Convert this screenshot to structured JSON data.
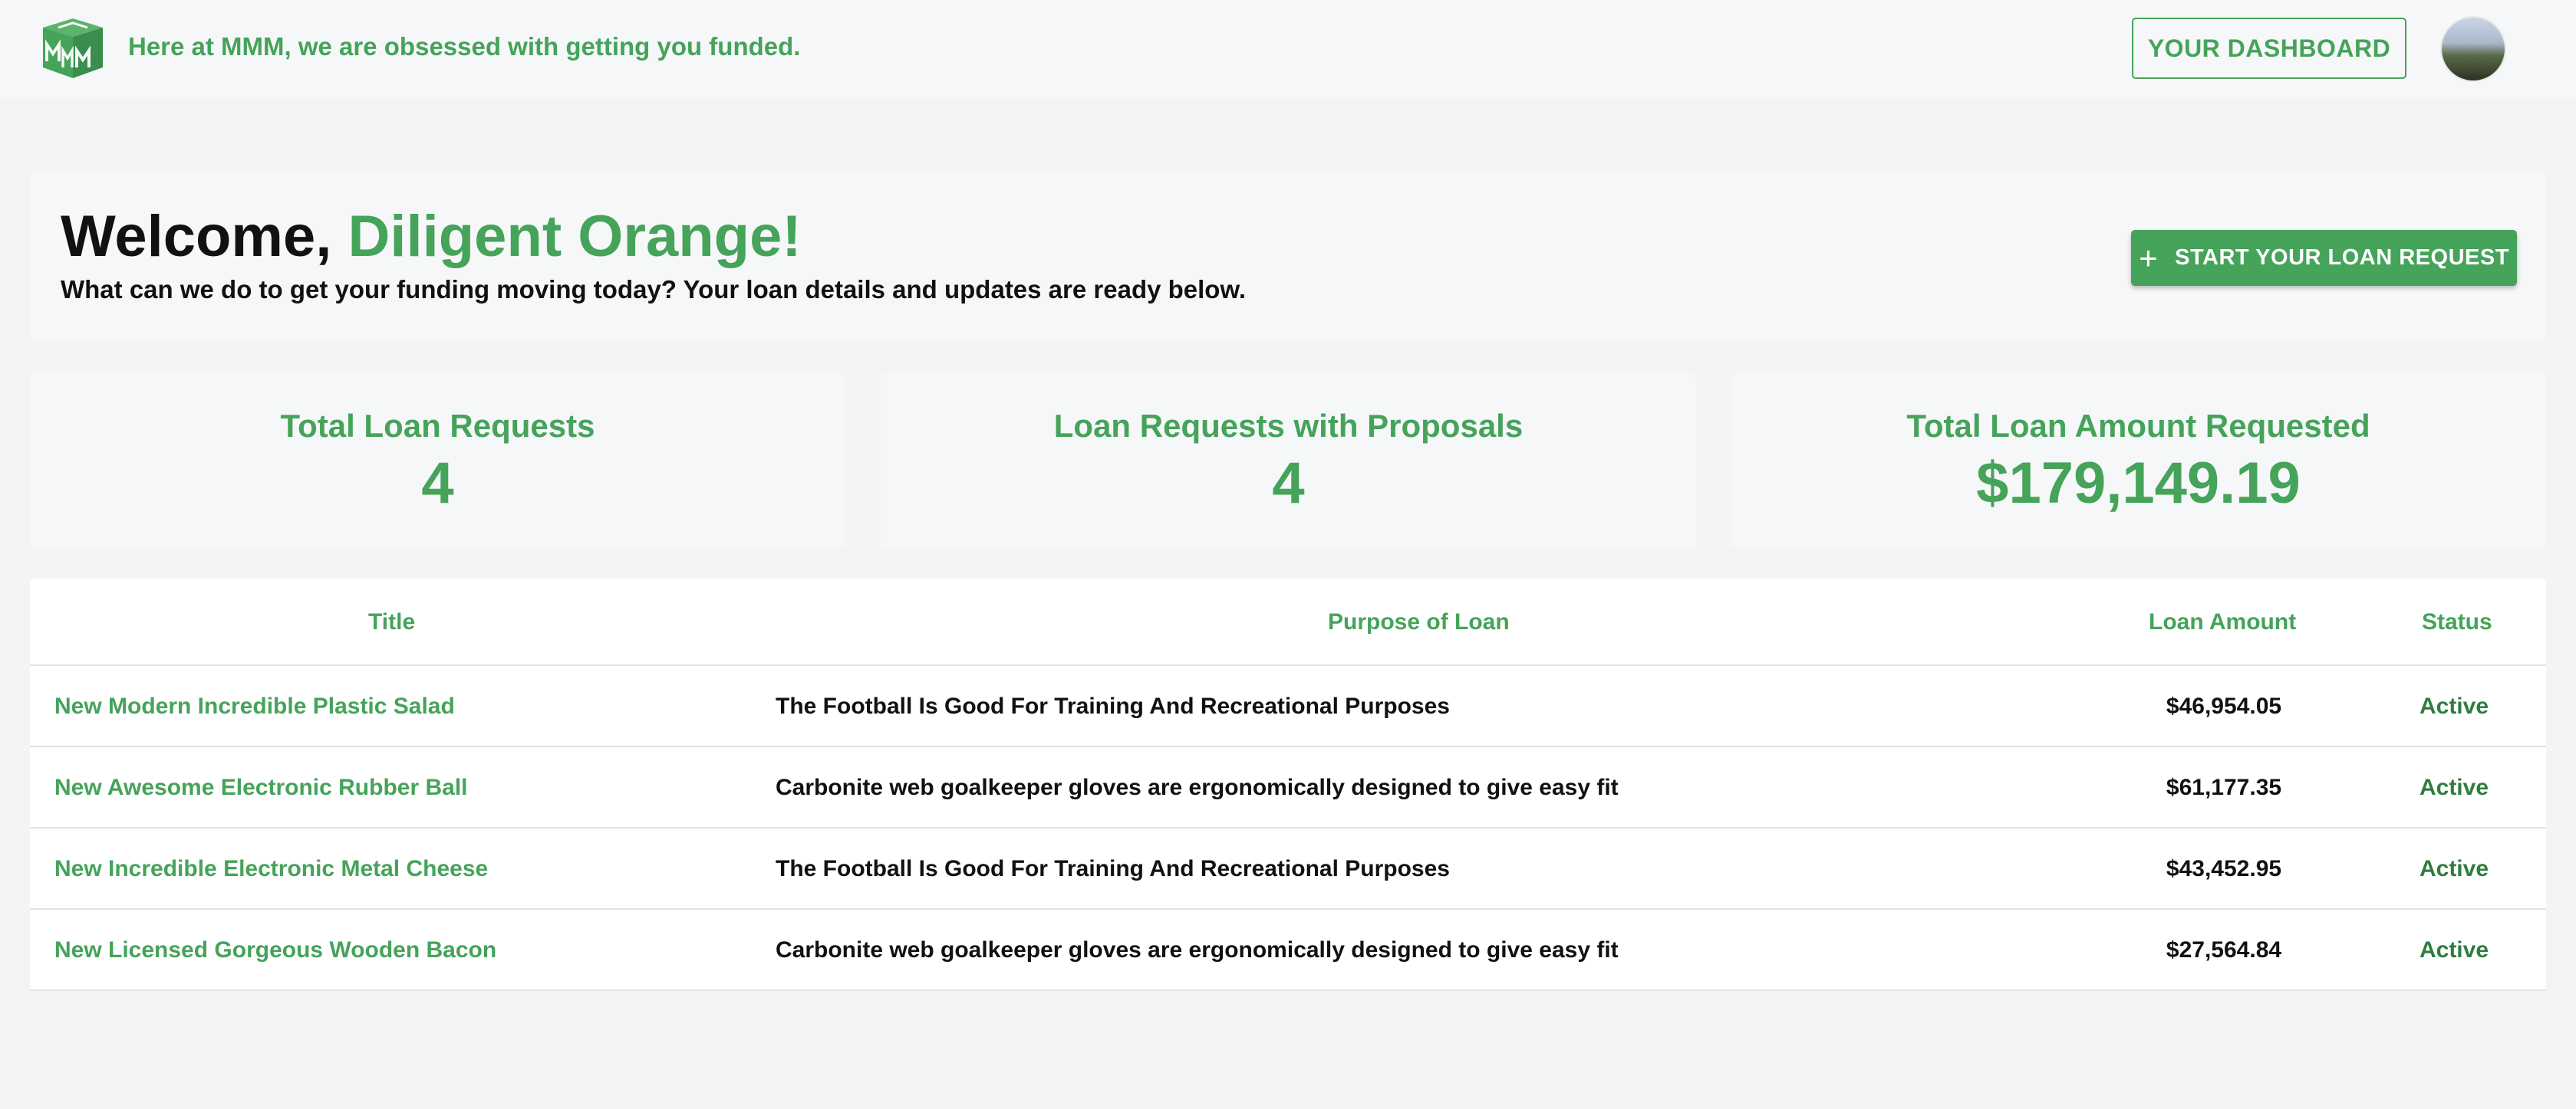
{
  "header": {
    "tagline": "Here at MMM, we are obsessed with getting you funded.",
    "dashboard_label": "YOUR DASHBOARD",
    "brand_color": "#45a35a"
  },
  "welcome": {
    "greeting": "Welcome, ",
    "name": "Diligent Orange!",
    "subtitle": "What can we do to get your funding moving today? Your loan details and updates are ready below.",
    "start_label": "START YOUR LOAN REQUEST",
    "start_icon": "plus-icon"
  },
  "stats": [
    {
      "label": "Total Loan Requests",
      "value": "4"
    },
    {
      "label": "Loan Requests with Proposals",
      "value": "4"
    },
    {
      "label": "Total Loan Amount Requested",
      "value": "$179,149.19"
    }
  ],
  "table": {
    "headers": {
      "title": "Title",
      "purpose": "Purpose of Loan",
      "amount": "Loan Amount",
      "status": "Status"
    },
    "rows": [
      {
        "title": "New Modern Incredible Plastic Salad",
        "purpose": "The Football Is Good For Training And Recreational Purposes",
        "amount": "$46,954.05",
        "status": "Active"
      },
      {
        "title": "New Awesome Electronic Rubber Ball",
        "purpose": "Carbonite web goalkeeper gloves are ergonomically designed to give easy fit",
        "amount": "$61,177.35",
        "status": "Active"
      },
      {
        "title": "New Incredible Electronic Metal Cheese",
        "purpose": "The Football Is Good For Training And Recreational Purposes",
        "amount": "$43,452.95",
        "status": "Active"
      },
      {
        "title": "New Licensed Gorgeous Wooden Bacon",
        "purpose": "Carbonite web goalkeeper gloves are ergonomically designed to give easy fit",
        "amount": "$27,564.84",
        "status": "Active"
      }
    ]
  }
}
